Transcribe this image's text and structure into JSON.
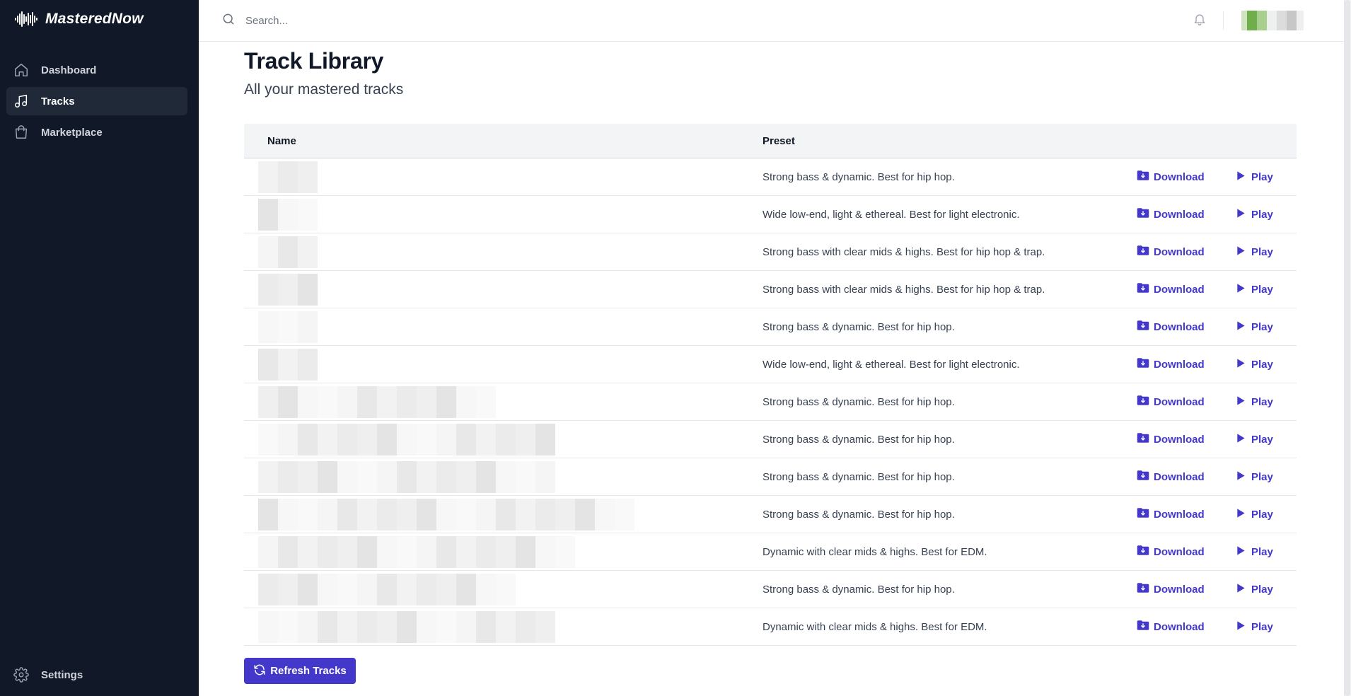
{
  "app": {
    "name": "MasteredNow"
  },
  "sidebar": {
    "items": [
      {
        "label": "Dashboard",
        "icon": "home-icon",
        "active": false
      },
      {
        "label": "Tracks",
        "icon": "music-note-icon",
        "active": true
      },
      {
        "label": "Marketplace",
        "icon": "shopping-bag-icon",
        "active": false
      }
    ],
    "settings": {
      "label": "Settings",
      "icon": "gear-icon"
    }
  },
  "header": {
    "search": {
      "placeholder": "Search...",
      "value": ""
    },
    "notifications_icon": "bell-icon",
    "avatar": "user-avatar (pixelated)"
  },
  "page": {
    "title": "Track Library",
    "subtitle": "All your mastered tracks"
  },
  "table": {
    "columns": [
      "Name",
      "Preset"
    ],
    "rows": [
      {
        "name": "",
        "preset": "Strong bass & dynamic. Best for hip hop.",
        "download_label": "Download",
        "play_label": "Play"
      },
      {
        "name": "",
        "preset": "Wide low-end, light & ethereal. Best for light electronic.",
        "download_label": "Download",
        "play_label": "Play"
      },
      {
        "name": "",
        "preset": "Strong bass with clear mids & highs. Best for hip hop & trap.",
        "download_label": "Download",
        "play_label": "Play"
      },
      {
        "name": "",
        "preset": "Strong bass with clear mids & highs. Best for hip hop & trap.",
        "download_label": "Download",
        "play_label": "Play"
      },
      {
        "name": "",
        "preset": "Strong bass & dynamic. Best for hip hop.",
        "download_label": "Download",
        "play_label": "Play"
      },
      {
        "name": "",
        "preset": "Wide low-end, light & ethereal. Best for light electronic.",
        "download_label": "Download",
        "play_label": "Play"
      },
      {
        "name": "",
        "preset": "Strong bass & dynamic. Best for hip hop.",
        "download_label": "Download",
        "play_label": "Play"
      },
      {
        "name": "",
        "preset": "Strong bass & dynamic. Best for hip hop.",
        "download_label": "Download",
        "play_label": "Play"
      },
      {
        "name": "",
        "preset": "Strong bass & dynamic. Best for hip hop.",
        "download_label": "Download",
        "play_label": "Play"
      },
      {
        "name": "",
        "preset": "Strong bass & dynamic. Best for hip hop.",
        "download_label": "Download",
        "play_label": "Play"
      },
      {
        "name": "",
        "preset": "Dynamic with clear mids & highs. Best for EDM.",
        "download_label": "Download",
        "play_label": "Play"
      },
      {
        "name": "",
        "preset": "Strong bass & dynamic. Best for hip hop.",
        "download_label": "Download",
        "play_label": "Play"
      },
      {
        "name": "",
        "preset": "Dynamic with clear mids & highs. Best for EDM.",
        "download_label": "Download",
        "play_label": "Play"
      }
    ]
  },
  "actions": {
    "refresh_label": "Refresh Tracks"
  },
  "colors": {
    "sidebar_bg": "#111827",
    "sidebar_active_bg": "#1f2937",
    "accent": "#4338ca",
    "table_header_bg": "#f3f4f6"
  }
}
